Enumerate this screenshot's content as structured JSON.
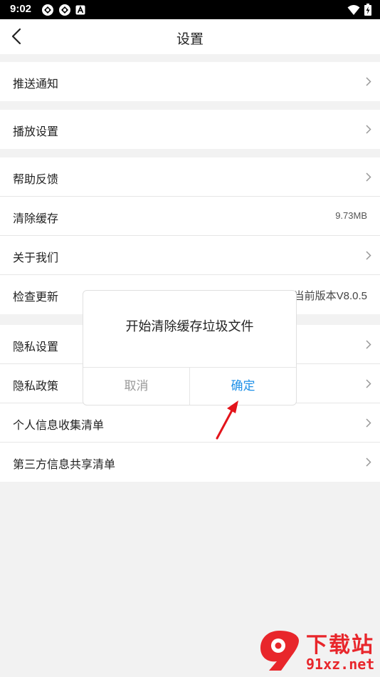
{
  "status_bar": {
    "time": "9:02"
  },
  "header": {
    "title": "设置"
  },
  "groups": [
    {
      "items": [
        {
          "label": "推送通知",
          "chevron": true
        }
      ]
    },
    {
      "items": [
        {
          "label": "播放设置",
          "chevron": true
        }
      ]
    },
    {
      "items": [
        {
          "label": "帮助反馈",
          "chevron": true
        },
        {
          "label": "清除缓存",
          "value": "9.73MB"
        },
        {
          "label": "关于我们",
          "chevron": true
        },
        {
          "label": "检查更新",
          "value": "当前版本V8.0.5"
        }
      ]
    },
    {
      "items": [
        {
          "label": "隐私设置",
          "chevron": true
        },
        {
          "label": "隐私政策",
          "chevron": true
        },
        {
          "label": "个人信息收集清单",
          "chevron": true
        },
        {
          "label": "第三方信息共享清单",
          "chevron": true
        }
      ]
    }
  ],
  "dialog": {
    "message": "开始清除缓存垃圾文件",
    "cancel_label": "取消",
    "confirm_label": "确定"
  },
  "watermark": {
    "title": "下载站",
    "url": "91xz.net"
  },
  "colors": {
    "accent": "#1e90e8",
    "annotation_arrow": "#e3141b",
    "watermark": "#e8262b"
  }
}
